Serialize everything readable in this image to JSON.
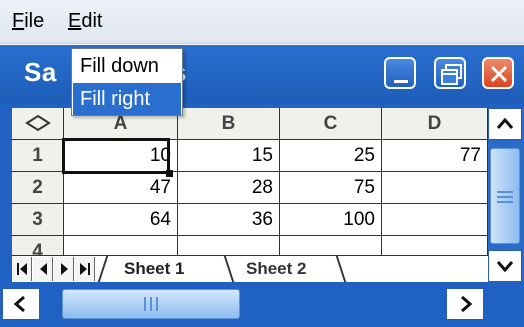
{
  "menubar": {
    "file_label": "File",
    "file_mnemonic": "F",
    "file_rest": "ile",
    "edit_label": "Edit",
    "edit_mnemonic": "E",
    "edit_rest": "dit"
  },
  "edit_menu": {
    "items": [
      {
        "label": "Fill down",
        "highlighted": false
      },
      {
        "label": "Fill right",
        "highlighted": true
      }
    ]
  },
  "window": {
    "title_visible_start": "Sa",
    "title_visible_end": "s",
    "accent_color": "#1f62c4",
    "buttons": [
      "minimize-icon",
      "restore-icon",
      "close-icon"
    ]
  },
  "sheet": {
    "corner_icon": "select-all-diamond-icon",
    "columns": [
      "A",
      "B",
      "C",
      "D"
    ],
    "rows": [
      {
        "header": "1",
        "cells": [
          "10",
          "15",
          "25",
          "77"
        ]
      },
      {
        "header": "2",
        "cells": [
          "47",
          "28",
          "75",
          ""
        ]
      },
      {
        "header": "3",
        "cells": [
          "64",
          "36",
          "100",
          ""
        ]
      },
      {
        "header": "4",
        "cells": [
          "",
          "",
          "",
          ""
        ]
      }
    ],
    "selected_cell": "A1"
  },
  "tabs": {
    "nav_icons": [
      "first-sheet-icon",
      "prev-sheet-icon",
      "next-sheet-icon",
      "last-sheet-icon"
    ],
    "sheets": [
      "Sheet 1",
      "Sheet 2"
    ],
    "active_sheet": "Sheet 1"
  },
  "scrollbars": {
    "vertical": {
      "up_icon": "chevron-up-icon",
      "down_icon": "chevron-down-icon",
      "grip_icon": "grip-lines-icon"
    },
    "horizontal": {
      "left_icon": "chevron-left-icon",
      "right_icon": "chevron-right-icon",
      "grip_icon": "grip-bars-icon"
    }
  }
}
